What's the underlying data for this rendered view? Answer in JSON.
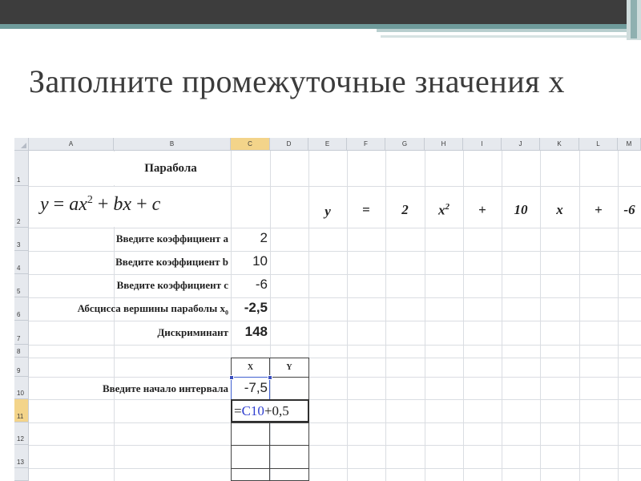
{
  "slide": {
    "title": "Заполните промежуточные значения х"
  },
  "sheet": {
    "columns": [
      "A",
      "B",
      "C",
      "D",
      "E",
      "F",
      "G",
      "H",
      "I",
      "J",
      "K",
      "L",
      "M"
    ],
    "rows": [
      "1",
      "2",
      "3",
      "4",
      "5",
      "6",
      "7",
      "8",
      "9",
      "10",
      "11",
      "12",
      "13"
    ],
    "title": "Парабола",
    "formula": {
      "y": "y",
      "eq": " = ",
      "a": "ax",
      "sup1": "2",
      "plus1": " + ",
      "b": "bx",
      "plus2": " + ",
      "c": "c"
    },
    "equation": {
      "y": "y",
      "eq": "=",
      "a": "2",
      "x2": "x",
      "x2sup": "2",
      "plus1": "+",
      "b": "10",
      "x": "x",
      "plus2": "+",
      "c": "-6"
    },
    "labels": {
      "coef_a": "Введите коэффициент а",
      "coef_b": "Введите коэффициент b",
      "coef_c": "Введите коэффициент с",
      "vertex": "Абсцисса вершины параболы x",
      "vertex_sub": "0",
      "discriminant": "Дискриминант",
      "interval_start": "Введите начало интервала"
    },
    "values": {
      "a": "2",
      "b": "10",
      "c": "-6",
      "vertex": "-2,5",
      "discriminant": "148",
      "interval_start": "-7,5"
    },
    "table_headers": {
      "x": "X",
      "y": "Y"
    },
    "edit_formula": {
      "eq": "=",
      "ref": "C10",
      "rest": "+0,5"
    },
    "accent": "#f3d48a",
    "ref_color": "#2f3fd0"
  }
}
